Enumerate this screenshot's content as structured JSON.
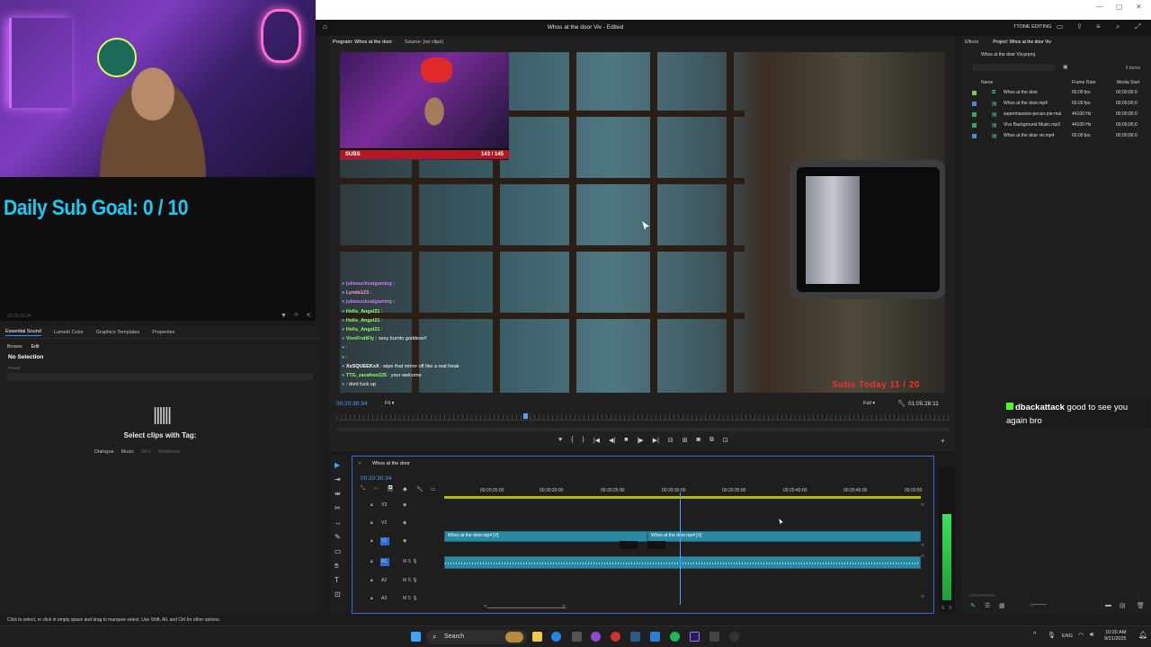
{
  "stream": {
    "goal_text": "Daily Sub Goal:  0 / 10",
    "goal_time": "00:20:30:34"
  },
  "essential_sound": {
    "tabs": [
      "Essential Sound",
      "Lumetri Color",
      "Graphics Templates",
      "Properties"
    ],
    "sub_tabs": [
      "Browse",
      "Edit"
    ],
    "no_selection": "No Selection",
    "preset_label": "Preset",
    "select_clips": "Select clips with Tag:",
    "tags": [
      "Dialogue",
      "Music",
      "SFX",
      "Ambience"
    ]
  },
  "app": {
    "title": "Whos at the door Viv - Edited",
    "workspace": "TTONE EDITING"
  },
  "program": {
    "tabs": [
      "Program: Whos at the door",
      "Source: (no clips)"
    ],
    "inset_subs_label": "SUBS",
    "inset_subs_count": "143 / 145",
    "subs_today": "Subs Today  11 / 20",
    "timecode_left": "00:20:30:34",
    "fit": "Fit",
    "quality": "Full",
    "timecode_right": "01:05:28:11",
    "chat": [
      {
        "user": "juliasucksatgaming",
        "msg": "",
        "color": "#c77dff"
      },
      {
        "user": "Lynda123",
        "msg": "",
        "color": "#ff9bd6"
      },
      {
        "user": "juliasucksatgaming",
        "msg": "",
        "color": "#c77dff"
      },
      {
        "user": "Hells_Angel21",
        "msg": "",
        "color": "#8dff6b"
      },
      {
        "user": "Hells_Angel21",
        "msg": "",
        "color": "#8dff6b"
      },
      {
        "user": "Hells_Angel21",
        "msg": "",
        "color": "#8dff6b"
      },
      {
        "user": "VivsFruitFly",
        "msg": "sexy burrito goddess!!",
        "color": "#8dff6b"
      },
      {
        "user": "",
        "msg": "",
        "color": "#ff5bd0"
      },
      {
        "user": "",
        "msg": "",
        "color": "#ff5bd0"
      },
      {
        "user": "XxSQUEEKxX",
        "msg": "wipe that mirror off like a real freak",
        "color": "#ffffff"
      },
      {
        "user": "TTG_zavahoo225",
        "msg": "your welcome",
        "color": "#8dff6b"
      },
      {
        "user": "",
        "msg": "dont fuck up",
        "color": "#ff5bd0"
      }
    ]
  },
  "project": {
    "tabs": [
      "Effects",
      "Project: Whos at the door Viv"
    ],
    "path": "Whos at the door Viv.prproj",
    "items_count": "5 items",
    "headers": {
      "name": "Name",
      "frame_rate": "Frame Rate",
      "media_start": "Media Start"
    },
    "items": [
      {
        "name": "Whos at the door",
        "rate": "60.00 fps",
        "start": "00;00;00;0",
        "color": "#8bc34a",
        "icon": "sequence-icon"
      },
      {
        "name": "Whos at the door.mp4",
        "rate": "60.00 fps",
        "start": "00;00;00;0",
        "color": "#3f8fd6",
        "icon": "video-file-icon"
      },
      {
        "name": "supermassive-pecan-pie-mai",
        "rate": "44100 Hz",
        "start": "00;00;00;0",
        "color": "#3aa36a",
        "icon": "audio-file-icon"
      },
      {
        "name": "Vivs Background Music.mp3",
        "rate": "44100 Hz",
        "start": "00;00;00;0",
        "color": "#3aa36a",
        "icon": "audio-file-icon"
      },
      {
        "name": "Whos at the door viv.mp4",
        "rate": "60.00 fps",
        "start": "00;00;00;0",
        "color": "#3f8fd6",
        "icon": "video-file-icon"
      }
    ]
  },
  "overlay_chat": {
    "user": "dbackattack",
    "message": " good to see you again bro"
  },
  "timeline": {
    "sequence": "Whos at the door",
    "timecode": "00:20:30:34",
    "ruler": [
      "00:20:25:00",
      "00:20:20:00",
      "00:20:25:00",
      "00:20:30:00",
      "00:20:35:00",
      "00:20:40:00",
      "00:20:45:00",
      "00:20:50"
    ],
    "tracks": [
      "V3",
      "V2",
      "V1",
      "A1",
      "A2",
      "A3"
    ],
    "clip1": "Whos at the door.mp4 [V]",
    "clip2": "Whos at the door.mp4 [V]"
  },
  "status_bar": "Click to select, or click in empty space and drag to marquee select. Use Shift, Alt, and Ctrl for other options.",
  "taskbar": {
    "search": "Search",
    "lang": "ENG",
    "time": "10:20 AM",
    "date": "9/21/2025"
  }
}
